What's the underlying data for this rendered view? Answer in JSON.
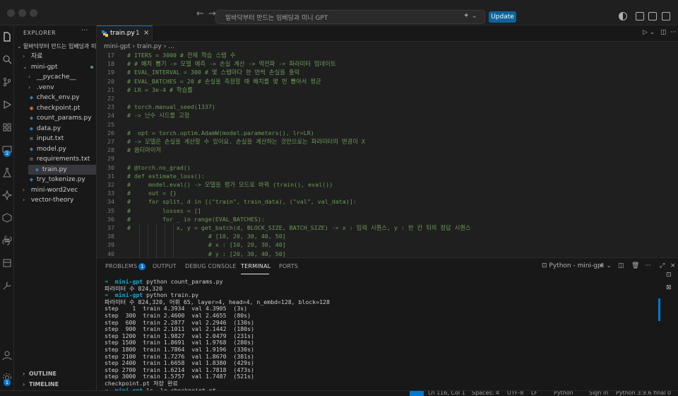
{
  "titlebar": {
    "search_text": "밑바닥부터 만드는 임베딩과 미니 GPT",
    "update_label": "Update"
  },
  "sidebar": {
    "title": "EXPLORER",
    "more": "···",
    "root": "밑바닥부터 만드는 임베딩과 미니...",
    "items": [
      {
        "label": "자료",
        "chev": "›",
        "icon": "",
        "badge": ""
      },
      {
        "label": "mini-gpt",
        "chev": "⌄",
        "icon": "",
        "badge": ""
      },
      {
        "label": "__pycache__",
        "chev": "›",
        "icon": "",
        "badge": ""
      },
      {
        "label": ".venv",
        "chev": "›",
        "icon": "",
        "badge": ""
      },
      {
        "label": "check_env.py",
        "chev": "",
        "icon": "py",
        "badge": ""
      },
      {
        "label": "checkpoint.pt",
        "chev": "",
        "icon": "pt",
        "badge": ""
      },
      {
        "label": "count_params.py",
        "chev": "",
        "icon": "py",
        "badge": ""
      },
      {
        "label": "data.py",
        "chev": "",
        "icon": "py",
        "badge": ""
      },
      {
        "label": "input.txt",
        "chev": "",
        "icon": "txt",
        "badge": ""
      },
      {
        "label": "model.py",
        "chev": "",
        "icon": "py",
        "badge": ""
      },
      {
        "label": "requirements.txt",
        "chev": "",
        "icon": "txt",
        "badge": ""
      },
      {
        "label": "train.py",
        "chev": "",
        "icon": "py",
        "badge": "1"
      },
      {
        "label": "try_tokenize.py",
        "chev": "",
        "icon": "py",
        "badge": ""
      },
      {
        "label": "mini-word2vec",
        "chev": "›",
        "icon": "",
        "badge": ""
      },
      {
        "label": "vector-theory",
        "chev": "›",
        "icon": "",
        "badge": ""
      }
    ],
    "outline": "OUTLINE",
    "timeline": "TIMELINE"
  },
  "activity_badges": {
    "source_control": "2",
    "accounts": "1"
  },
  "editor": {
    "tab_label": "train.py",
    "tab_problems": "1",
    "tab_close": "×",
    "breadcrumb": "mini-gpt  ›  train.py  ›  ...",
    "lines": [
      {
        "n": "17",
        "text": "# ITERS = 3000 # 전체 학습 스텝 수"
      },
      {
        "n": "18",
        "text": "# # 배치 뽑기 -> 모델 예측 -> 손실 계산 -> 역전파 -> 파라미터 업데이트"
      },
      {
        "n": "19",
        "text": "# EVAL_INTERVAL = 300 # 몇 스텝마다 한 번씩 손실을 출력"
      },
      {
        "n": "20",
        "text": "# EVAL_BATCHES = 20 # 손실을 측정할 때 배치를 몇 번 뽑아서 평균"
      },
      {
        "n": "21",
        "text": "# LR = 3e-4 # 학습률"
      },
      {
        "n": "22",
        "text": ""
      },
      {
        "n": "23",
        "text": "# torch.manual_seed(1337)"
      },
      {
        "n": "24",
        "text": "# -> 난수 시드를 고정"
      },
      {
        "n": "25",
        "text": ""
      },
      {
        "n": "26",
        "text": "#  opt = torch.optim.AdamW(model.parameters(), lr=LR)"
      },
      {
        "n": "27",
        "text": "# -> 모델은 손실을 계산할 수 있어요. 손실을 계산하는 것만으로는 파라미터의 변경이 X"
      },
      {
        "n": "28",
        "text": "# 옵티마이저"
      },
      {
        "n": "29",
        "text": ""
      },
      {
        "n": "30",
        "text": "# @torch.no_grad()"
      },
      {
        "n": "31",
        "text": "# def estimate_loss():"
      },
      {
        "n": "32",
        "text": "#     model.eval() -> 모델을 평가 모드로 바꿔 (train(), eval())"
      },
      {
        "n": "33",
        "text": "#     out = {}"
      },
      {
        "n": "34",
        "text": "#     for split, d in [(\"train\", train_data), (\"val\", val_data)]:"
      },
      {
        "n": "35",
        "text": "#         losses = []"
      },
      {
        "n": "36",
        "text": "#         for _ in range(EVAL_BATCHES):"
      },
      {
        "n": "37",
        "text": "#             x, y = get_batch(d, BLOCK_SIZE, BATCH_SIZE) -> x : 입력 시퀀스, y : 한 칸 뒤의 정답 시퀀스"
      },
      {
        "n": "38",
        "text": "                       # [10, 20, 30, 40, 50]"
      },
      {
        "n": "39",
        "text": "                       # x : [10, 20, 30, 40]"
      },
      {
        "n": "40",
        "text": "                       # y : [20, 30, 40, 50]"
      }
    ]
  },
  "panel": {
    "tabs": [
      "PROBLEMS",
      "OUTPUT",
      "DEBUG CONSOLE",
      "TERMINAL",
      "PORTS"
    ],
    "problems_count": "1",
    "terminal_name": "Python - mini-gpt",
    "plus": "+",
    "terminal_lines": [
      {
        "type": "prompt",
        "dir": "mini-gpt",
        "cmd": "python count_params.py"
      },
      {
        "type": "out",
        "text": "파라미터 수 824,320"
      },
      {
        "type": "prompt",
        "dir": "mini-gpt",
        "cmd": "python train.py"
      },
      {
        "type": "out",
        "text": "파라미터 수 824,320, 어휘 65, layer=4, head=4, n_embd=128, block=128"
      },
      {
        "type": "out",
        "text": "step    1  train 4.3934  val 4.3905  (3s)"
      },
      {
        "type": "out",
        "text": "step  300  train 2.4600  val 2.4655  (80s)"
      },
      {
        "type": "out",
        "text": "step  600  train 2.2877  val 2.2946  (130s)"
      },
      {
        "type": "out",
        "text": "step  900  train 2.1011  val 2.1442  (180s)"
      },
      {
        "type": "out",
        "text": "step 1200  train 1.9827  val 2.0479  (231s)"
      },
      {
        "type": "out",
        "text": "step 1500  train 1.8691  val 1.9768  (280s)"
      },
      {
        "type": "out",
        "text": "step 1800  train 1.7864  val 1.9196  (330s)"
      },
      {
        "type": "out",
        "text": "step 2100  train 1.7276  val 1.8670  (381s)"
      },
      {
        "type": "out",
        "text": "step 2400  train 1.6658  val 1.8380  (429s)"
      },
      {
        "type": "out",
        "text": "step 2700  train 1.6214  val 1.7818  (473s)"
      },
      {
        "type": "out",
        "text": "step 3000  train 1.5757  val 1.7487  (521s)"
      },
      {
        "type": "out",
        "text": "checkpoint.pt 저장 완료"
      },
      {
        "type": "prompt",
        "dir": "mini-gpt",
        "cmd": "ls -la checkpoint.pt"
      }
    ]
  },
  "statusbar": {
    "position": "Ln 116, Col 1",
    "spaces": "Spaces: 4",
    "encoding": "UTF-8",
    "eol": "LF",
    "language": "Python",
    "signin": "Sign in",
    "interpreter": "Python 3.9.6 final 0"
  },
  "colors": {
    "accent": "#0078d4",
    "comment": "#6a9955",
    "prompt_arrow": "#0dbc79",
    "prompt_dir": "#11a8cd"
  }
}
